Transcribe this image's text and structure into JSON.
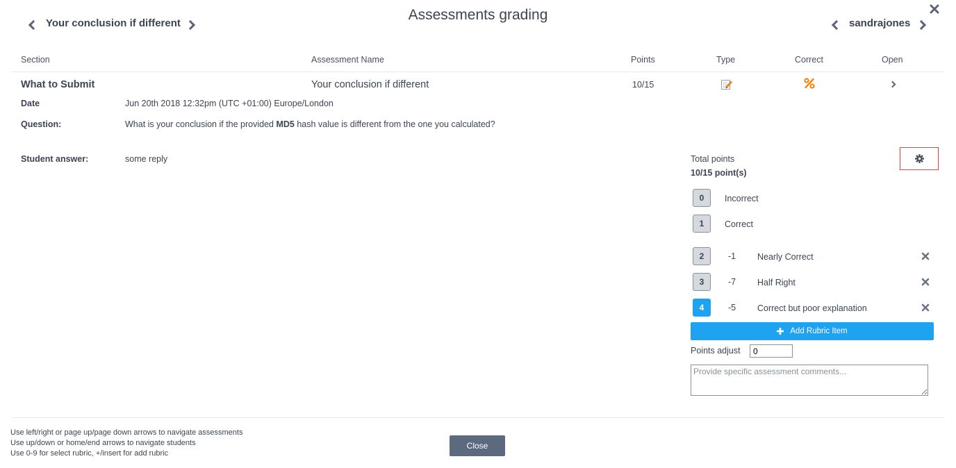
{
  "header": {
    "title": "Assessments grading",
    "assessment_nav_label": "Your conclusion if different",
    "student_nav_label": "sandrajones"
  },
  "columns": {
    "section": "Section",
    "assessment_name": "Assessment Name",
    "points": "Points",
    "type": "Type",
    "correct": "Correct",
    "open": "Open"
  },
  "row": {
    "section": "What to Submit",
    "assessment_name": "Your conclusion if different",
    "points": "10/15"
  },
  "details": {
    "date_label": "Date",
    "date_value": "Jun 20th 2018 12:32pm (UTC +01:00) Europe/London",
    "question_label": "Question:",
    "question_pre": "What is your conclusion if the provided ",
    "question_bold": "MD5",
    "question_post": " hash value is different from the one you calculated?",
    "student_answer_label": "Student answer:",
    "student_answer_value": "some reply"
  },
  "grading": {
    "total_points_label": "Total points",
    "total_points_value": "10/15 point(s)",
    "rubric": [
      {
        "key": "0",
        "delta": "",
        "label": "Incorrect",
        "removable": false,
        "active": false
      },
      {
        "key": "1",
        "delta": "",
        "label": "Correct",
        "removable": false,
        "active": false
      },
      {
        "key": "2",
        "delta": "-1",
        "label": "Nearly Correct",
        "removable": true,
        "active": false
      },
      {
        "key": "3",
        "delta": "-7",
        "label": "Half Right",
        "removable": true,
        "active": false
      },
      {
        "key": "4",
        "delta": "-5",
        "label": "Correct but poor explanation",
        "removable": true,
        "active": true
      }
    ],
    "add_rubric_label": "Add Rubric Item",
    "points_adjust_label": "Points adjust",
    "points_adjust_value": "0",
    "comments_placeholder": "Provide specific assessment comments..."
  },
  "footer": {
    "hints": [
      "Use left/right or page up/page down arrows to navigate assessments",
      "Use up/down or home/end arrows to navigate students",
      "Use 0-9 for select rubric, +/insert for add rubric"
    ],
    "close_label": "Close"
  },
  "colors": {
    "accent": "#1fa3f0",
    "close_button": "#5c6a80",
    "correct_icon": "#f07d00",
    "settings_highlight": "#e0403a"
  },
  "icons": {
    "type": "edit-note-icon",
    "correct": "percent-icon",
    "settings": "gear-icon",
    "window_close": "close-icon"
  }
}
